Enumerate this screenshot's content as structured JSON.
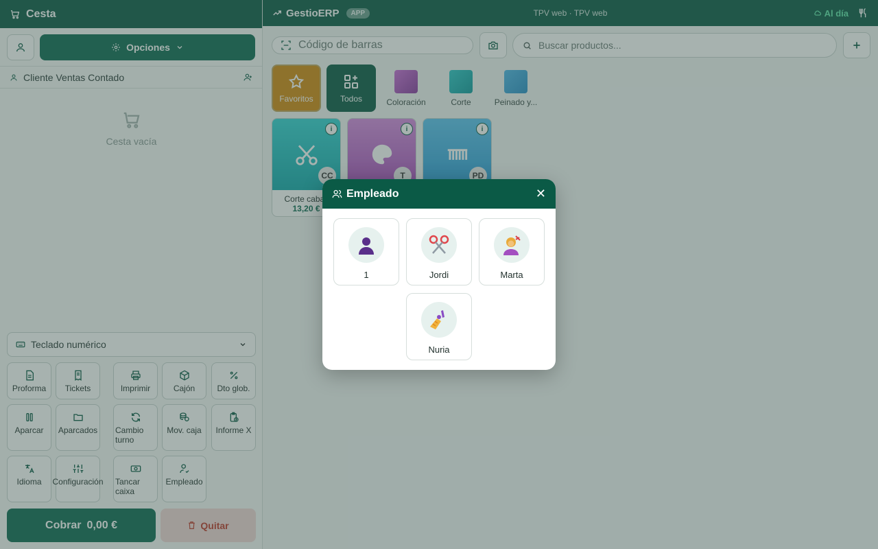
{
  "left": {
    "title": "Cesta",
    "options_label": "Opciones",
    "client": "Cliente Ventas Contado",
    "empty_text": "Cesta vacía",
    "numpad_label": "Teclado numérico",
    "actions": [
      {
        "label": "Proforma"
      },
      {
        "label": "Tickets"
      },
      {
        "label": "Imprimir"
      },
      {
        "label": "Cajón"
      },
      {
        "label": "Dto glob."
      },
      {
        "label": "Aparcar"
      },
      {
        "label": "Aparcados"
      },
      {
        "label": "Cambio turno"
      },
      {
        "label": "Mov. caja"
      },
      {
        "label": "Informe X"
      },
      {
        "label": "Idioma"
      },
      {
        "label": "Configuración"
      },
      {
        "label": "Tancar caixa"
      },
      {
        "label": "Empleado"
      }
    ],
    "cobrar_label": "Cobrar",
    "cobrar_amount": "0,00 €",
    "quitar_label": "Quitar"
  },
  "header": {
    "brand": "GestioERP",
    "badge": "APP",
    "center": "TPV web · TPV web",
    "status": "Al día"
  },
  "search": {
    "barcode_placeholder": "Código de barras",
    "search_placeholder": "Buscar productos..."
  },
  "categories": [
    {
      "label": "Favoritos"
    },
    {
      "label": "Todos"
    },
    {
      "label": "Coloración"
    },
    {
      "label": "Corte"
    },
    {
      "label": "Peinado y..."
    }
  ],
  "products": [
    {
      "name": "Corte caball",
      "price": "13,20 €",
      "badge": "CC"
    },
    {
      "name": "",
      "price": "",
      "badge": "T"
    },
    {
      "name": "",
      "price": "",
      "badge": "PD"
    }
  ],
  "modal": {
    "title": "Empleado",
    "employees": [
      {
        "name": "1"
      },
      {
        "name": "Jordi"
      },
      {
        "name": "Marta"
      },
      {
        "name": "Nuria"
      }
    ]
  },
  "colors": {
    "primary": "#0b5a46",
    "favorites": "#d28a12",
    "danger": "#c0392b",
    "status_ok": "#5fe3a9"
  }
}
